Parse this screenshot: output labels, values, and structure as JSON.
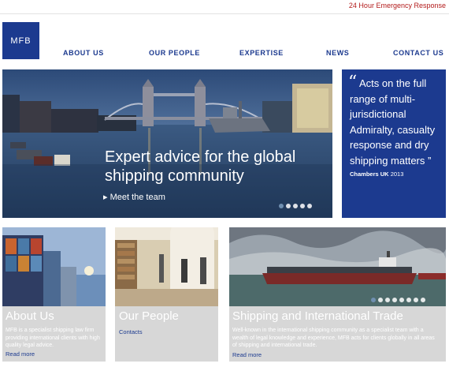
{
  "topbar": {
    "emergency_link": "24 Hour Emergency Response"
  },
  "logo": {
    "text": "MFB"
  },
  "nav": {
    "items": [
      {
        "label": "ABOUT US"
      },
      {
        "label": "OUR PEOPLE"
      },
      {
        "label": "EXPERTISE"
      },
      {
        "label": "NEWS"
      },
      {
        "label": "CONTACT US"
      }
    ]
  },
  "hero": {
    "headline": "Expert advice for the global shipping community",
    "link": "Meet the team",
    "slide_count": 5,
    "active_slide": 1
  },
  "quote": {
    "open_mark": "“",
    "text": "Acts on the full range of multi-jurisdictional Admiralty, casualty response and dry shipping matters ”",
    "source_name": "Chambers UK",
    "source_year": "2013"
  },
  "cards": [
    {
      "title": "About Us",
      "text": "MFB is a specialist shipping law firm providing international clients with high quality legal advice.",
      "link": "Read more"
    },
    {
      "title": "Our People",
      "text": "",
      "link": "Contacts"
    },
    {
      "title": "Shipping and International Trade",
      "text": "Well-known in the international shipping community as a specialist team with a wealth of legal knowledge and experience, MFB acts for clients globally in all areas of shipping and international trade.",
      "link": "Read more",
      "slide_count": 8,
      "active_slide": 1
    }
  ],
  "colors": {
    "brand_blue": "#1c3a8f",
    "emergency_red": "#b31b1b",
    "panel_grey": "#d7d7d7"
  }
}
